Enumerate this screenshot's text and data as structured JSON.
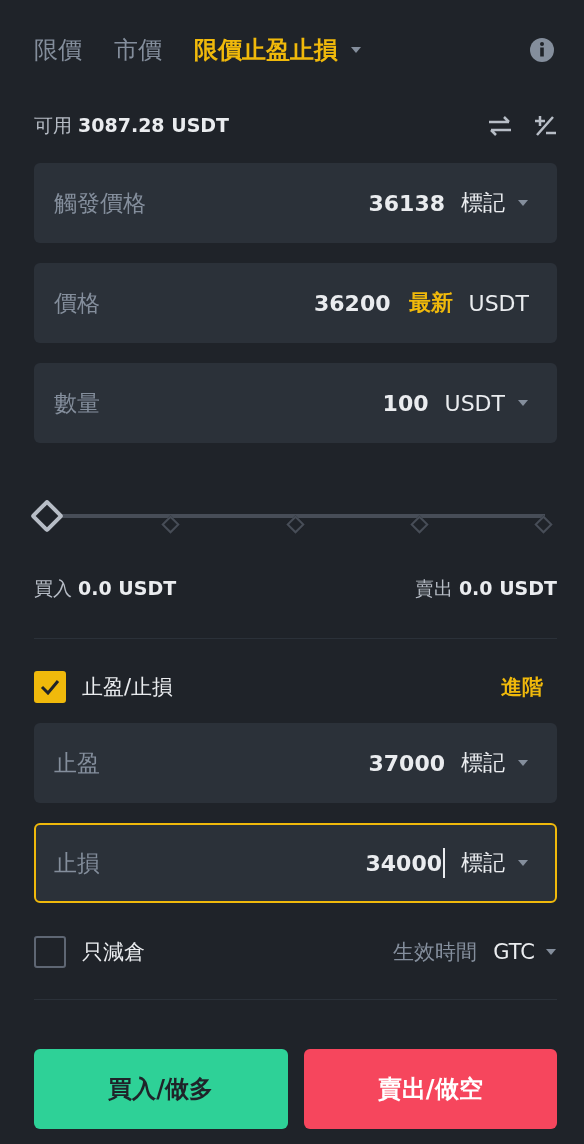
{
  "order_types": [
    {
      "label": "限價",
      "selected": false,
      "dropdown": false
    },
    {
      "label": "市價",
      "selected": false,
      "dropdown": false
    },
    {
      "label": "限價止盈止損",
      "selected": true,
      "dropdown": true
    }
  ],
  "available": {
    "label": "可用",
    "value": "3087.28 USDT"
  },
  "fields": [
    {
      "label": "觸發價格",
      "value": "36138",
      "unit": "標記",
      "dropdown": true,
      "focused": false
    },
    {
      "label": "價格",
      "value": "36200",
      "tag": "最新",
      "unit": "USDT",
      "dropdown": false,
      "focused": false
    },
    {
      "label": "數量",
      "value": "100",
      "unit": "USDT",
      "dropdown": true,
      "focused": false
    }
  ],
  "slider": {
    "level": 0
  },
  "buy_amount": {
    "label": "買入",
    "value": "0.0 USDT"
  },
  "sell_amount": {
    "label": "賣出",
    "value": "0.0 USDT"
  },
  "tpsl": {
    "label": "止盈/止損",
    "checked": true,
    "advanced": "進階"
  },
  "tpsl_fields": [
    {
      "label": "止盈",
      "value": "37000",
      "unit": "標記",
      "dropdown": true,
      "focused": false
    },
    {
      "label": "止損",
      "value": "34000",
      "unit": "標記",
      "dropdown": true,
      "focused": true
    }
  ],
  "reduce_only": {
    "label": "只減倉",
    "checked": false
  },
  "time_in_force": {
    "label": "生效時間",
    "value": "GTC"
  },
  "buttons": [
    {
      "label": "買入/做多",
      "kind": "buy"
    },
    {
      "label": "賣出/做空",
      "kind": "sell"
    }
  ]
}
